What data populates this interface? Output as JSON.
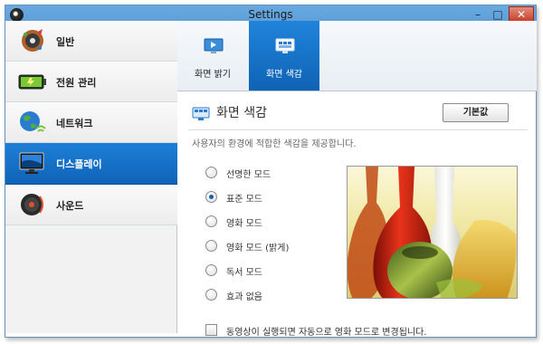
{
  "window": {
    "title": "Settings"
  },
  "sidebar": {
    "items": [
      {
        "label": "일반",
        "icon": "gear-palette-icon",
        "active": false
      },
      {
        "label": "전원 관리",
        "icon": "battery-icon",
        "active": false
      },
      {
        "label": "네트워크",
        "icon": "globe-wifi-icon",
        "active": false
      },
      {
        "label": "디스플레이",
        "icon": "monitor-icon",
        "active": true
      },
      {
        "label": "사운드",
        "icon": "speaker-icon",
        "active": false
      }
    ]
  },
  "tabs": [
    {
      "label": "화면 밝기",
      "icon": "brightness-icon",
      "active": false
    },
    {
      "label": "화면 색감",
      "icon": "color-tone-icon",
      "active": true
    }
  ],
  "section": {
    "title": "화면 색감",
    "default_button": "기본값",
    "description": "사용자의 환경에 적합한 색감을 제공합니다."
  },
  "color_modes": {
    "selected": "표준 모드",
    "options": [
      "선명한 모드",
      "표준 모드",
      "영화 모드",
      "영화 모드 (밝게)",
      "독서 모드",
      "효과 없음"
    ]
  },
  "movie_mode_checkbox": {
    "label": "동영상이 실행되면 자동으로 영화 모드로 변경됩니다.",
    "checked": false
  },
  "preview": {
    "description_icon": "glass-vases-image"
  },
  "colors": {
    "accent": "#0f64b8",
    "titlebar": "#5d9ed8",
    "close": "#c7412b"
  }
}
